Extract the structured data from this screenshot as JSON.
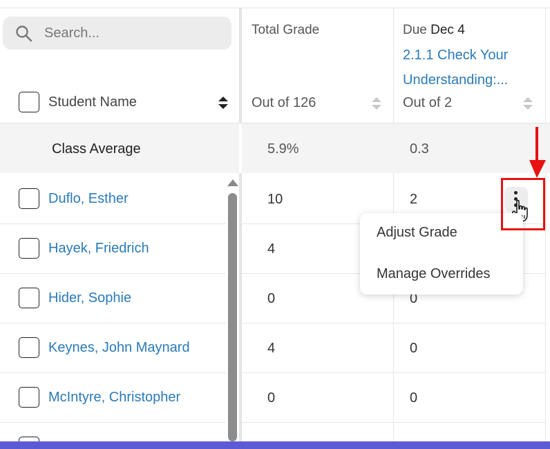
{
  "search": {
    "placeholder": "Search..."
  },
  "headers": {
    "student_name": "Student Name",
    "total_grade": "Total Grade",
    "total_out_of": "Out of 126",
    "assignment_due_prefix": "Due",
    "assignment_due_date": "Dec 4",
    "assignment_title_line1": "2.1.1 Check Your",
    "assignment_title_line2": "Understanding:...",
    "assignment_out_of": "Out of 2"
  },
  "class_average": {
    "label": "Class Average",
    "total": "5.9%",
    "assignment": "0.3"
  },
  "students": [
    {
      "name": "Duflo, Esther",
      "total": "10",
      "assignment": "2"
    },
    {
      "name": "Hayek, Friedrich",
      "total": "4",
      "assignment": ""
    },
    {
      "name": "Hider, Sophie",
      "total": "0",
      "assignment": "0"
    },
    {
      "name": "Keynes, John Maynard",
      "total": "4",
      "assignment": "0"
    },
    {
      "name": "McIntyre, Christopher",
      "total": "0",
      "assignment": "0"
    }
  ],
  "context_menu": {
    "items": [
      "Adjust Grade",
      "Manage Overrides"
    ]
  },
  "colors": {
    "link": "#2a7ab8",
    "highlight": "#e81010",
    "bottom_bar": "#5b5bd6"
  }
}
